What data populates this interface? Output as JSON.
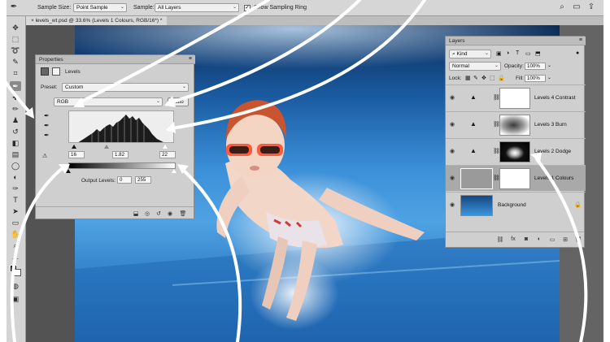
{
  "options_bar": {
    "sample_size_label": "Sample Size:",
    "sample_size_value": "Point Sample",
    "sample_label": "Sample:",
    "sample_value": "All Layers",
    "show_sampling_ring_label": "Show Sampling Ring",
    "show_sampling_ring_checked": true
  },
  "document_tab": {
    "title": "levels_wt.psd @ 33.6% (Levels 1 Colours, RGB/16*) *"
  },
  "properties": {
    "panel_title": "Properties",
    "adjustment_name": "Levels",
    "preset_label": "Preset:",
    "preset_value": "Custom",
    "channel_value": "RGB",
    "auto_label": "Auto",
    "input_black": "16",
    "input_gamma": "1.82",
    "input_white": "22",
    "output_levels_label": "Output Levels:",
    "output_black": "0",
    "output_white": "255"
  },
  "layers": {
    "panel_title": "Layers",
    "filter_value": "Kind",
    "blend_mode": "Normal",
    "opacity_label": "Opacity:",
    "opacity_value": "100%",
    "lock_label": "Lock:",
    "fill_label": "Fill:",
    "fill_value": "100%",
    "rows": [
      {
        "name": "Levels 4 Contrast",
        "mask": "white",
        "selected": false
      },
      {
        "name": "Levels 3 Burn",
        "mask": "blur",
        "selected": false
      },
      {
        "name": "Levels 2 Dodge",
        "mask": "dark",
        "selected": false
      },
      {
        "name": "Levels 1 Colours",
        "mask": "white",
        "selected": true
      },
      {
        "name": "Background",
        "mask": "photo",
        "selected": false
      }
    ]
  },
  "colors": {
    "workspace": "#535353",
    "panel_bg": "#cfcfcf",
    "annotation_arrows": "#ffffff",
    "goggles": "#ff5a3a"
  }
}
